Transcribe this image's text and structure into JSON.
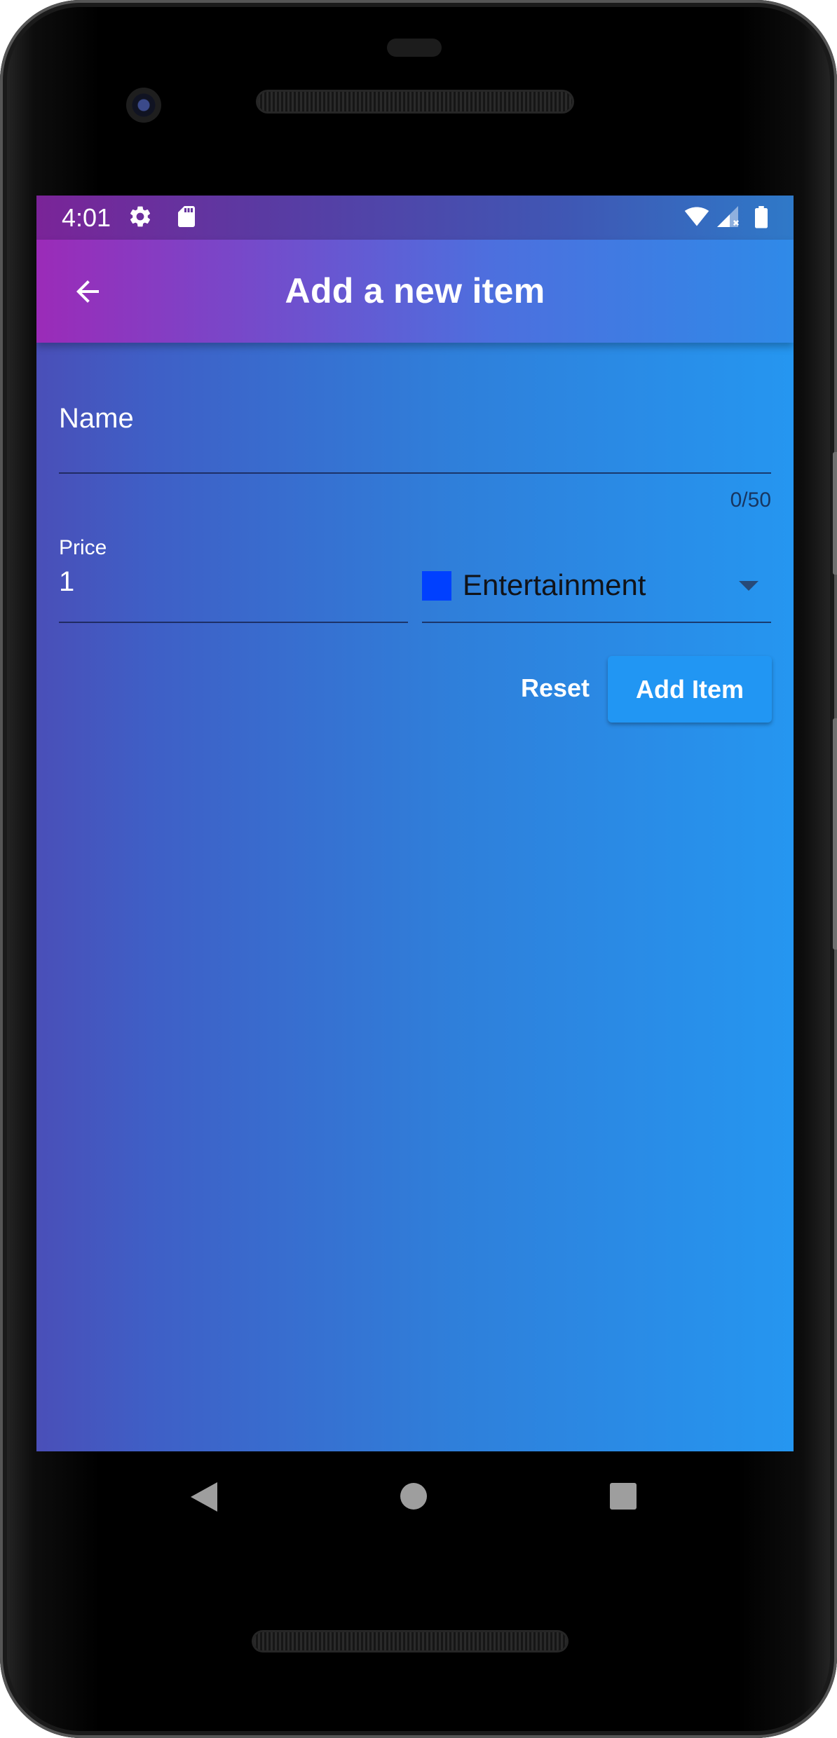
{
  "status_bar": {
    "time": "4:01",
    "icons": [
      "settings-icon",
      "sd-card-icon",
      "wifi-icon",
      "cell-signal-icon",
      "battery-icon"
    ]
  },
  "app_bar": {
    "title": "Add a new item",
    "back_icon": "arrow-back-icon"
  },
  "form": {
    "name": {
      "label": "Name",
      "value": "",
      "counter": "0/50"
    },
    "price": {
      "label": "Price",
      "value": "1"
    },
    "category": {
      "selected": "Entertainment",
      "swatch_color": "#0040ff",
      "arrow_icon": "dropdown-arrow-icon"
    },
    "buttons": {
      "reset_label": "Reset",
      "add_label": "Add Item"
    }
  },
  "nav_bar": {
    "icons": [
      "nav-back-icon",
      "nav-home-icon",
      "nav-recents-icon"
    ]
  },
  "colors": {
    "accent": "#2196f3",
    "app_bar_start": "#9b2bb8",
    "app_bar_end": "#2f8ae8",
    "background_start": "#4a4fb8",
    "background_end": "#2596f0"
  }
}
